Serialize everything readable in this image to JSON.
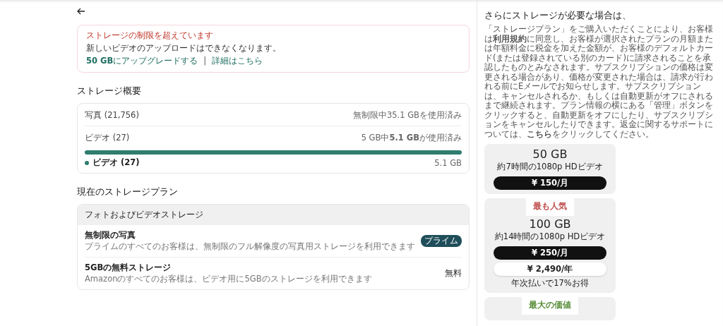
{
  "alert": {
    "title": "ストレージの制限を超えています",
    "message": "新しいビデオのアップロードはできなくなります。",
    "links": [
      {
        "text": "**50 GB**にアップグレードする"
      },
      {
        "text": "詳細はこちら"
      }
    ],
    "separator": "|"
  },
  "overview": {
    "heading": "ストレージ概要",
    "rows": [
      {
        "label": "写真 (21,756)",
        "usage": "無制限中35.1 GBを使用済み"
      },
      {
        "label": "ビデオ (27)",
        "usage": "5 GB中**5.1 GB**が使用済み",
        "level": 1,
        "legend": {
          "label": "ビデオ (27)",
          "color": "#2e7d6e",
          "value": "5.1 GB"
        }
      }
    ]
  },
  "plan": {
    "heading": "現在のストレージプラン",
    "section": "フォトおよびビデオストレージ",
    "items": [
      {
        "title": "無制限の写真",
        "description": "プライムのすべてのお客様は、無制限のフル解像度の写真用ストレージを利用できます",
        "badge": "プライム",
        "kind": "badge"
      },
      {
        "title": "5GBの無料ストレージ",
        "description": "Amazonのすべてのお客様は、ビデオ用に5GBのストレージを利用できます",
        "badge": "無料",
        "kind": "text"
      }
    ]
  },
  "side": {
    "heading": "さらにストレージが必要な場合は、",
    "terms": "「ストレージプラン」をご購入いただくことにより、お客様は**利用規約**に同意し、お客様が選択されたプランの月額または年額料金に税金を加えた金額が、お客様のデフォルトカード(または登録されている別のカード)に請求されることを承認したものとみなされます。サブスクリプションの価格は変更される場合があり、価格が変更された場合は、請求が行われる前にEメールでお知らせします。サブスクリプションは、キャンセルされるか、もしくは自動更新がオフにされるまで継続されます。プラン情報の横にある「管理」ボタンをクリックすると、自動更新をオフにしたり、サブスクリプションをキャンセルしたりできます。返金に関するサポートについては、**こちら**をクリックしてください。",
    "plans": [
      {
        "size": "50 GB",
        "description": "約7時間の1080p HDビデオ",
        "buttons": [
          {
            "label": "¥ 150/月",
            "kind": "primary"
          }
        ]
      },
      {
        "ribbon": "最も人気",
        "color": "#c0504d",
        "size": "100 GB",
        "description": "約14時間の1080p HDビデオ",
        "buttons": [
          {
            "label": "¥ 250/月",
            "kind": "primary"
          },
          {
            "label": "¥ 2,490/年",
            "kind": "secondary"
          }
        ],
        "note": "年次払いで17%お得"
      },
      {
        "ribbon": "最大の価値",
        "color": "#5a8f3c"
      }
    ]
  }
}
